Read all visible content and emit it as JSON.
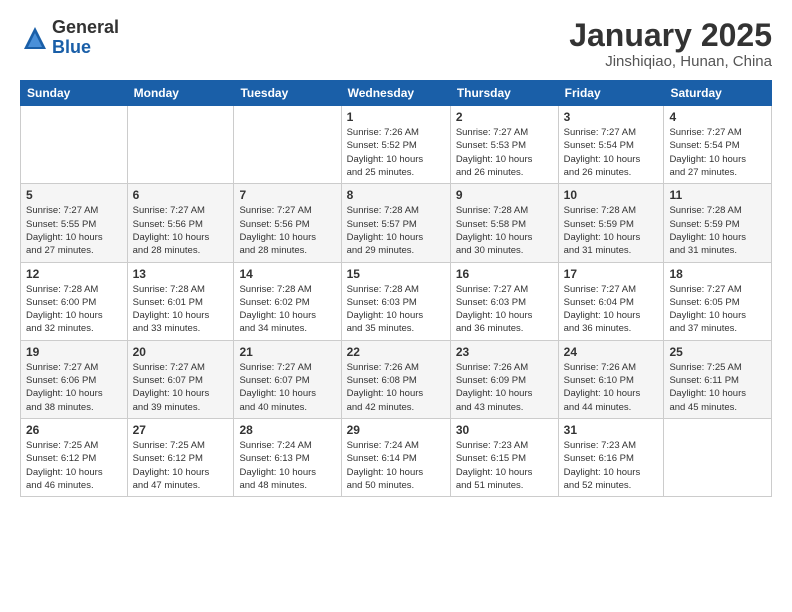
{
  "logo": {
    "general": "General",
    "blue": "Blue"
  },
  "title": {
    "month": "January 2025",
    "location": "Jinshiqiao, Hunan, China"
  },
  "weekdays": [
    "Sunday",
    "Monday",
    "Tuesday",
    "Wednesday",
    "Thursday",
    "Friday",
    "Saturday"
  ],
  "weeks": [
    [
      {
        "day": "",
        "info": ""
      },
      {
        "day": "",
        "info": ""
      },
      {
        "day": "",
        "info": ""
      },
      {
        "day": "1",
        "info": "Sunrise: 7:26 AM\nSunset: 5:52 PM\nDaylight: 10 hours\nand 25 minutes."
      },
      {
        "day": "2",
        "info": "Sunrise: 7:27 AM\nSunset: 5:53 PM\nDaylight: 10 hours\nand 26 minutes."
      },
      {
        "day": "3",
        "info": "Sunrise: 7:27 AM\nSunset: 5:54 PM\nDaylight: 10 hours\nand 26 minutes."
      },
      {
        "day": "4",
        "info": "Sunrise: 7:27 AM\nSunset: 5:54 PM\nDaylight: 10 hours\nand 27 minutes."
      }
    ],
    [
      {
        "day": "5",
        "info": "Sunrise: 7:27 AM\nSunset: 5:55 PM\nDaylight: 10 hours\nand 27 minutes."
      },
      {
        "day": "6",
        "info": "Sunrise: 7:27 AM\nSunset: 5:56 PM\nDaylight: 10 hours\nand 28 minutes."
      },
      {
        "day": "7",
        "info": "Sunrise: 7:27 AM\nSunset: 5:56 PM\nDaylight: 10 hours\nand 28 minutes."
      },
      {
        "day": "8",
        "info": "Sunrise: 7:28 AM\nSunset: 5:57 PM\nDaylight: 10 hours\nand 29 minutes."
      },
      {
        "day": "9",
        "info": "Sunrise: 7:28 AM\nSunset: 5:58 PM\nDaylight: 10 hours\nand 30 minutes."
      },
      {
        "day": "10",
        "info": "Sunrise: 7:28 AM\nSunset: 5:59 PM\nDaylight: 10 hours\nand 31 minutes."
      },
      {
        "day": "11",
        "info": "Sunrise: 7:28 AM\nSunset: 5:59 PM\nDaylight: 10 hours\nand 31 minutes."
      }
    ],
    [
      {
        "day": "12",
        "info": "Sunrise: 7:28 AM\nSunset: 6:00 PM\nDaylight: 10 hours\nand 32 minutes."
      },
      {
        "day": "13",
        "info": "Sunrise: 7:28 AM\nSunset: 6:01 PM\nDaylight: 10 hours\nand 33 minutes."
      },
      {
        "day": "14",
        "info": "Sunrise: 7:28 AM\nSunset: 6:02 PM\nDaylight: 10 hours\nand 34 minutes."
      },
      {
        "day": "15",
        "info": "Sunrise: 7:28 AM\nSunset: 6:03 PM\nDaylight: 10 hours\nand 35 minutes."
      },
      {
        "day": "16",
        "info": "Sunrise: 7:27 AM\nSunset: 6:03 PM\nDaylight: 10 hours\nand 36 minutes."
      },
      {
        "day": "17",
        "info": "Sunrise: 7:27 AM\nSunset: 6:04 PM\nDaylight: 10 hours\nand 36 minutes."
      },
      {
        "day": "18",
        "info": "Sunrise: 7:27 AM\nSunset: 6:05 PM\nDaylight: 10 hours\nand 37 minutes."
      }
    ],
    [
      {
        "day": "19",
        "info": "Sunrise: 7:27 AM\nSunset: 6:06 PM\nDaylight: 10 hours\nand 38 minutes."
      },
      {
        "day": "20",
        "info": "Sunrise: 7:27 AM\nSunset: 6:07 PM\nDaylight: 10 hours\nand 39 minutes."
      },
      {
        "day": "21",
        "info": "Sunrise: 7:27 AM\nSunset: 6:07 PM\nDaylight: 10 hours\nand 40 minutes."
      },
      {
        "day": "22",
        "info": "Sunrise: 7:26 AM\nSunset: 6:08 PM\nDaylight: 10 hours\nand 42 minutes."
      },
      {
        "day": "23",
        "info": "Sunrise: 7:26 AM\nSunset: 6:09 PM\nDaylight: 10 hours\nand 43 minutes."
      },
      {
        "day": "24",
        "info": "Sunrise: 7:26 AM\nSunset: 6:10 PM\nDaylight: 10 hours\nand 44 minutes."
      },
      {
        "day": "25",
        "info": "Sunrise: 7:25 AM\nSunset: 6:11 PM\nDaylight: 10 hours\nand 45 minutes."
      }
    ],
    [
      {
        "day": "26",
        "info": "Sunrise: 7:25 AM\nSunset: 6:12 PM\nDaylight: 10 hours\nand 46 minutes."
      },
      {
        "day": "27",
        "info": "Sunrise: 7:25 AM\nSunset: 6:12 PM\nDaylight: 10 hours\nand 47 minutes."
      },
      {
        "day": "28",
        "info": "Sunrise: 7:24 AM\nSunset: 6:13 PM\nDaylight: 10 hours\nand 48 minutes."
      },
      {
        "day": "29",
        "info": "Sunrise: 7:24 AM\nSunset: 6:14 PM\nDaylight: 10 hours\nand 50 minutes."
      },
      {
        "day": "30",
        "info": "Sunrise: 7:23 AM\nSunset: 6:15 PM\nDaylight: 10 hours\nand 51 minutes."
      },
      {
        "day": "31",
        "info": "Sunrise: 7:23 AM\nSunset: 6:16 PM\nDaylight: 10 hours\nand 52 minutes."
      },
      {
        "day": "",
        "info": ""
      }
    ]
  ]
}
